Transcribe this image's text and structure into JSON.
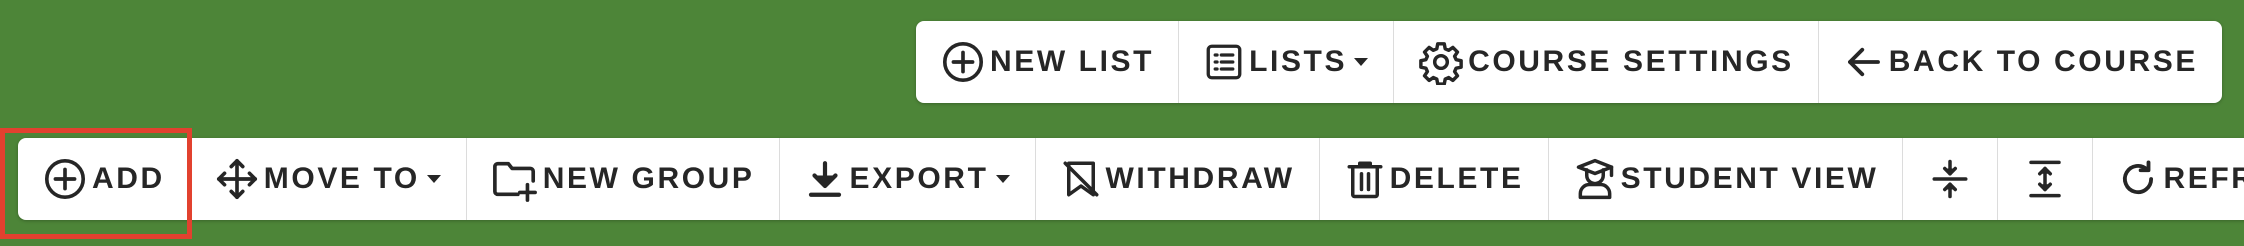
{
  "top_toolbar": {
    "new_list_label": "NEW LIST",
    "lists_label": "LISTS",
    "course_settings_label": "COURSE SETTINGS",
    "back_to_course_label": "BACK TO COURSE"
  },
  "main_toolbar": {
    "add_label": "ADD",
    "move_to_label": "MOVE TO",
    "new_group_label": "NEW GROUP",
    "export_label": "EXPORT",
    "withdraw_label": "WITHDRAW",
    "delete_label": "DELETE",
    "student_view_label": "STUDENT VIEW",
    "refresh_label": "REFRESH"
  },
  "icons": {
    "new_list": "circle-plus-icon",
    "lists": "list-icon",
    "course_settings": "gear-icon",
    "back_to_course": "arrow-left-icon",
    "add": "circle-plus-icon",
    "move_to": "move-arrows-icon",
    "new_group": "folder-plus-icon",
    "export": "download-icon",
    "withdraw": "withdraw-icon",
    "delete": "trash-icon",
    "student_view": "student-icon",
    "collapse": "collapse-icon",
    "expand": "expand-icon",
    "refresh": "refresh-icon"
  },
  "colors": {
    "background": "#4d8538",
    "toolbar_bg": "#ffffff",
    "text": "#262626",
    "highlight": "#e2412f"
  }
}
